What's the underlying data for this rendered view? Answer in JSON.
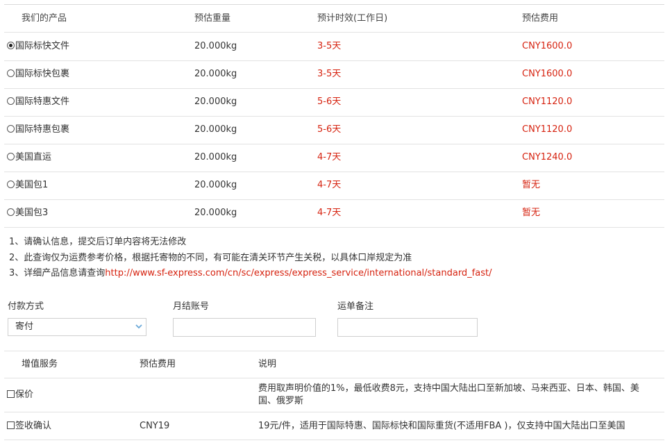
{
  "table": {
    "headers": [
      "我们的产品",
      "预估重量",
      "预计时效(工作日)",
      "预估费用"
    ],
    "rows": [
      {
        "product": "国际标快文件",
        "weight": "20.000kg",
        "time": "3-5天",
        "fee": "CNY1600.0",
        "selected": true
      },
      {
        "product": "国际标快包裹",
        "weight": "20.000kg",
        "time": "3-5天",
        "fee": "CNY1600.0",
        "selected": false
      },
      {
        "product": "国际特惠文件",
        "weight": "20.000kg",
        "time": "5-6天",
        "fee": "CNY1120.0",
        "selected": false
      },
      {
        "product": "国际特惠包裹",
        "weight": "20.000kg",
        "time": "5-6天",
        "fee": "CNY1120.0",
        "selected": false
      },
      {
        "product": "美国直运",
        "weight": "20.000kg",
        "time": "4-7天",
        "fee": "CNY1240.0",
        "selected": false
      },
      {
        "product": "美国包1",
        "weight": "20.000kg",
        "time": "4-7天",
        "fee": "暂无",
        "selected": false
      },
      {
        "product": "美国包3",
        "weight": "20.000kg",
        "time": "4-7天",
        "fee": "暂无",
        "selected": false
      }
    ]
  },
  "notes": {
    "n1": "1、请确认信息，提交后订单内容将无法修改",
    "n2": "2、此查询仅为运费参考价格，根据托寄物的不同，有可能在清关环节产生关税，以具体口岸规定为准",
    "n3_prefix": "3、详细产品信息请查询",
    "n3_link": "http://www.sf-express.com/cn/sc/express/express_service/international/standard_fast/"
  },
  "form": {
    "payment_label": "付款方式",
    "payment_value": "寄付",
    "account_label": "月结账号",
    "account_value": "",
    "remark_label": "运单备注",
    "remark_value": ""
  },
  "value_added": {
    "headers": [
      "增值服务",
      "预估费用",
      "说明"
    ],
    "rows": [
      {
        "name": "保价",
        "fee": "",
        "desc": "费用取声明价值的1%，最低收费8元，支持中国大陆出口至新加坡、马来西亚、日本、韩国、美国、俄罗斯",
        "checked": false
      },
      {
        "name": "签收确认",
        "fee": "CNY19",
        "desc": "19元/件，适用于国际特惠、国际标快和国际重货(不适用FBA )，仅支持中国大陆出口至美国",
        "checked": false
      }
    ]
  },
  "colors": {
    "accent_red": "#d6220f",
    "border": "#e2e2e2"
  },
  "icons": {
    "select": "chevron-down-icon"
  }
}
